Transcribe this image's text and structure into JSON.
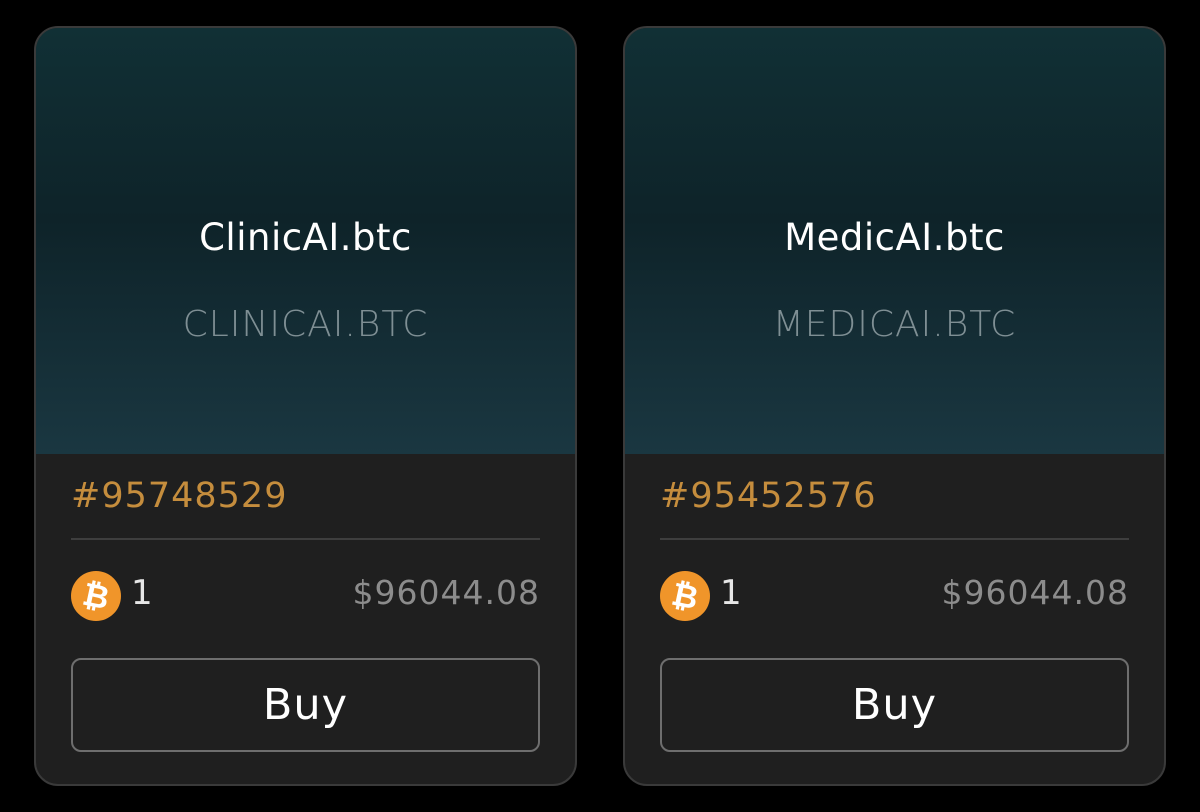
{
  "cards": [
    {
      "title": "ClinicAI.btc",
      "subtitle": "CLINICAI.BTC",
      "number": "#95748529",
      "amount": "1",
      "usd": "$96044.08",
      "buy_label": "Buy",
      "currency_icon": "bitcoin-icon"
    },
    {
      "title": "MedicAI.btc",
      "subtitle": "MEDICAI.BTC",
      "number": "#95452576",
      "amount": "1",
      "usd": "$96044.08",
      "buy_label": "Buy",
      "currency_icon": "bitcoin-icon"
    }
  ],
  "colors": {
    "accent": "#c58d3d",
    "bitcoin": "#f0952a",
    "card_bg": "#1f1f1f"
  }
}
